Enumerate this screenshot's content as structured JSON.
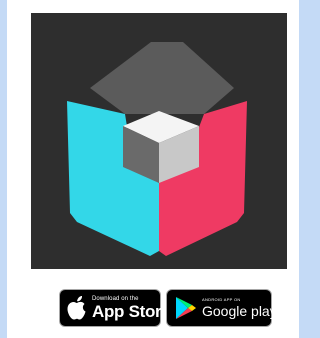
{
  "colors": {
    "page_background": "#c4daf6",
    "card_background": "#ffffff",
    "icon_background": "#2e2e2e",
    "cube_top": "#5b5b5b",
    "cube_left": "#33d7e8",
    "cube_right": "#ef3a63",
    "inner_top": "#f4f4f4",
    "inner_left": "#6a6a6a",
    "inner_right": "#c8c8c8",
    "badge_background": "#000000",
    "badge_text": "#ffffff"
  },
  "app_icon": {
    "icon": "cube-logo-icon"
  },
  "store_badges": {
    "app_store": {
      "icon": "apple-icon",
      "small_text": "Download on the",
      "large_text": "App Store"
    },
    "google_play": {
      "icon": "play-triangle-icon",
      "small_text": "ANDROID APP ON",
      "large_text": "Google play"
    }
  }
}
